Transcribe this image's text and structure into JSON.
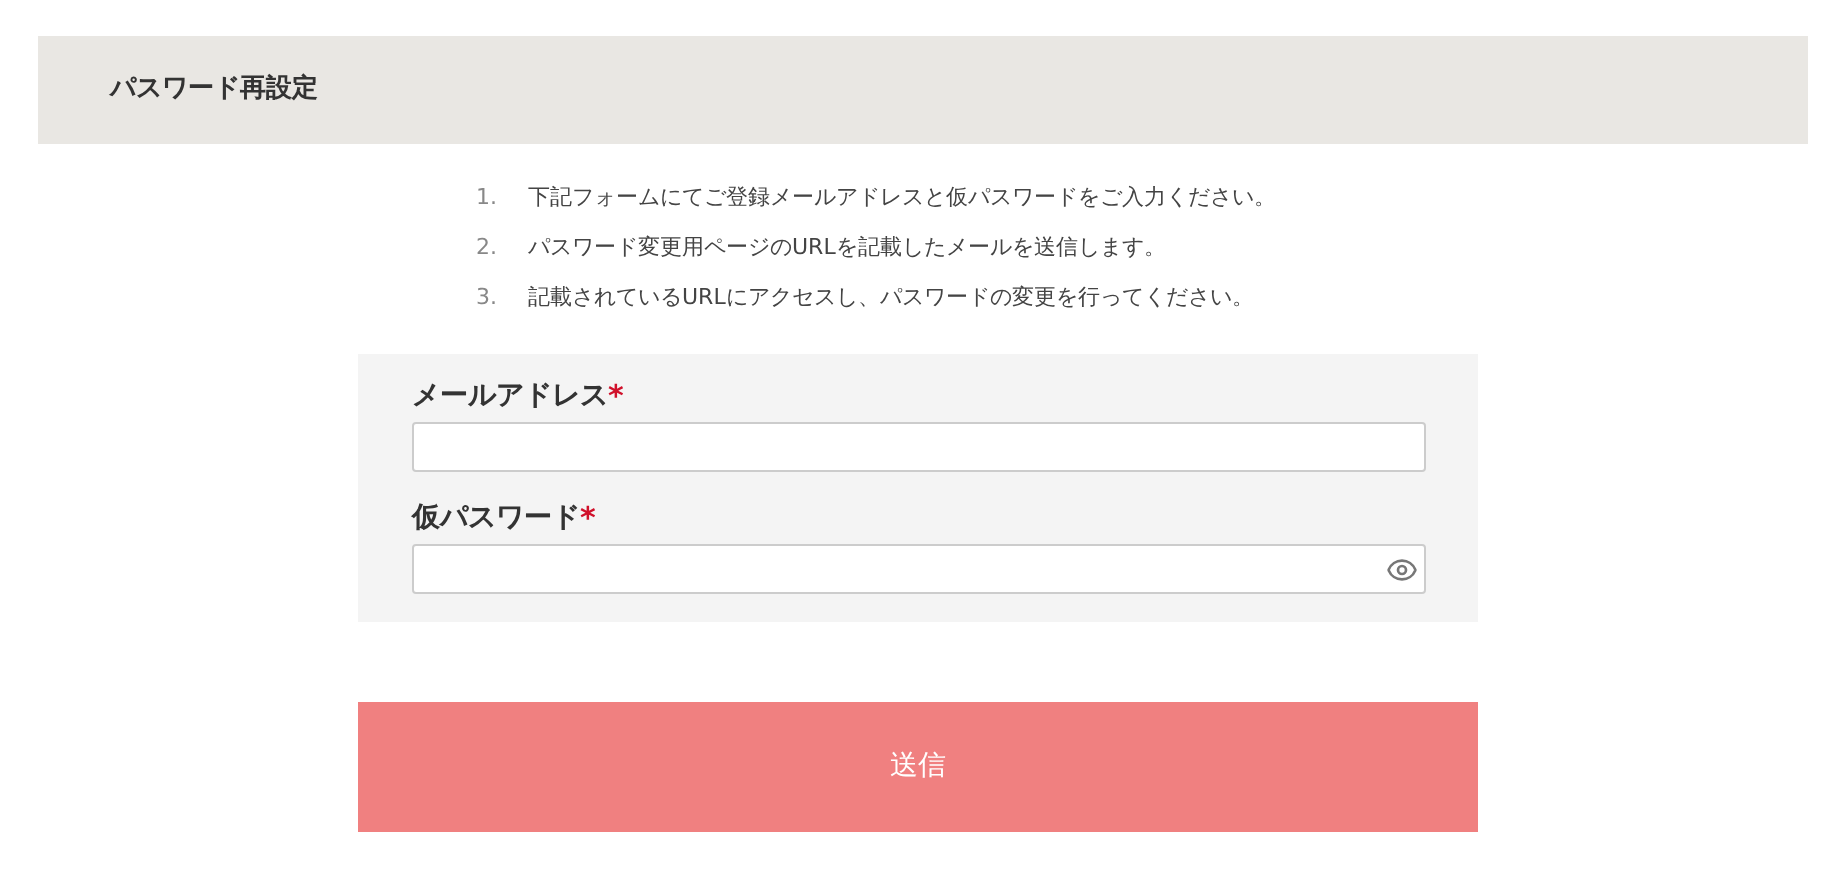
{
  "header": {
    "title": "パスワード再設定"
  },
  "steps": [
    {
      "number": "1.",
      "text": "下記フォームにてご登録メールアドレスと仮パスワードをご入力ください。"
    },
    {
      "number": "2.",
      "text": "パスワード変更用ページのURLを記載したメールを送信します。"
    },
    {
      "number": "3.",
      "text": "記載されているURLにアクセスし、パスワードの変更を行ってください。"
    }
  ],
  "fields": [
    {
      "label": "メールアドレス",
      "required_mark": "*",
      "kind": "text"
    },
    {
      "label": "仮パスワード",
      "required_mark": "*",
      "kind": "password"
    }
  ],
  "submit": {
    "label": "送信"
  }
}
